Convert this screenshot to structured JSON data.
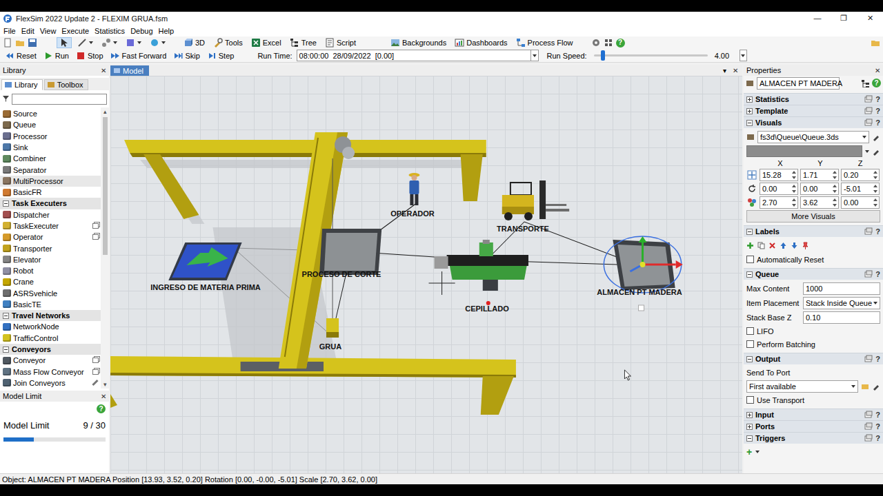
{
  "window": {
    "title": "FlexSim 2022 Update 2 - FLEXIM GRUA.fsm",
    "controls": [
      "—",
      "❐",
      "✕"
    ]
  },
  "menu": [
    {
      "label": "File"
    },
    {
      "label": "Edit"
    },
    {
      "label": "View"
    },
    {
      "label": "Execute"
    },
    {
      "label": "Statistics"
    },
    {
      "label": "Debug"
    },
    {
      "label": "Help"
    }
  ],
  "toolbar": {
    "tools": [
      {
        "label": "3D",
        "kind": "3d",
        "group": "left"
      },
      {
        "label": "Tools",
        "kind": "tools",
        "group": "left"
      },
      {
        "label": "Excel",
        "kind": "excel",
        "group": "left"
      },
      {
        "label": "Tree",
        "kind": "tree",
        "group": "left"
      },
      {
        "label": "Script",
        "kind": "script",
        "group": "left"
      },
      {
        "label": "Backgrounds",
        "kind": "backgrounds",
        "group": "right"
      },
      {
        "label": "Dashboards",
        "kind": "dashboards",
        "group": "right"
      },
      {
        "label": "Process Flow",
        "kind": "flow",
        "group": "right"
      }
    ],
    "help": "?"
  },
  "run_bar": {
    "buttons": [
      {
        "label": "Reset",
        "kind": "reset"
      },
      {
        "label": "Run",
        "kind": "run"
      },
      {
        "label": "Stop",
        "kind": "stop"
      },
      {
        "label": "Fast Forward",
        "kind": "ff"
      },
      {
        "label": "Skip",
        "kind": "skip"
      },
      {
        "label": "Step",
        "kind": "step"
      }
    ],
    "time_label": "Run Time:",
    "time": "08:00:00  28/09/2022  [0.00]",
    "speed_label": "Run Speed:",
    "speed": "4.00",
    "speed_level": 0.08
  },
  "library": {
    "title": "Library",
    "close": "✕",
    "tabs": [
      {
        "label": "Library",
        "selected": true
      },
      {
        "label": "Toolbox",
        "selected": false
      }
    ],
    "search": {
      "placeholder": ""
    },
    "scroll_up": "▴",
    "scroll_down": "▾",
    "items": [
      {
        "kind": "item",
        "label": "Source",
        "color": "#9a6b33",
        "marker": "none",
        "highlighted": false
      },
      {
        "kind": "item",
        "label": "Queue",
        "color": "#7d6a4d",
        "marker": "none",
        "highlighted": false
      },
      {
        "kind": "item",
        "label": "Processor",
        "color": "#6b6f8f",
        "marker": "none",
        "highlighted": false
      },
      {
        "kind": "item",
        "label": "Sink",
        "color": "#4e78a8",
        "marker": "none",
        "highlighted": false
      },
      {
        "kind": "item",
        "label": "Combiner",
        "color": "#5f8a5f",
        "marker": "none",
        "highlighted": false
      },
      {
        "kind": "item",
        "label": "Separator",
        "color": "#7a7a7a",
        "marker": "none",
        "highlighted": false
      },
      {
        "kind": "item",
        "label": "MultiProcessor",
        "color": "#8a7560",
        "marker": "none",
        "highlighted": true
      },
      {
        "kind": "item",
        "label": "BasicFR",
        "color": "#d07a30",
        "marker": "none",
        "highlighted": false
      },
      {
        "kind": "category",
        "label": "Task Executers",
        "expanded": true
      },
      {
        "kind": "item",
        "label": "Dispatcher",
        "color": "#a34f4f",
        "marker": "none",
        "highlighted": false
      },
      {
        "kind": "item",
        "label": "TaskExecuter",
        "color": "#d2b030",
        "marker": "box",
        "highlighted": false
      },
      {
        "kind": "item",
        "label": "Operator",
        "color": "#d59a2a",
        "marker": "box",
        "highlighted": false
      },
      {
        "kind": "item",
        "label": "Transporter",
        "color": "#c2a31e",
        "marker": "none",
        "highlighted": false
      },
      {
        "kind": "item",
        "label": "Elevator",
        "color": "#858585",
        "marker": "none",
        "highlighted": false
      },
      {
        "kind": "item",
        "label": "Robot",
        "color": "#8f8fa3",
        "marker": "none",
        "highlighted": false
      },
      {
        "kind": "item",
        "label": "Crane",
        "color": "#c4a600",
        "marker": "none",
        "highlighted": false
      },
      {
        "kind": "item",
        "label": "ASRSvehicle",
        "color": "#6e6e6e",
        "marker": "none",
        "highlighted": false
      },
      {
        "kind": "item",
        "label": "BasicTE",
        "color": "#3f80c2",
        "marker": "none",
        "highlighted": false
      },
      {
        "kind": "category",
        "label": "Travel Networks",
        "expanded": true
      },
      {
        "kind": "item",
        "label": "NetworkNode",
        "color": "#3270c0",
        "marker": "none",
        "highlighted": false
      },
      {
        "kind": "item",
        "label": "TrafficControl",
        "color": "#d3c21f",
        "marker": "none",
        "highlighted": false
      },
      {
        "kind": "category",
        "label": "Conveyors",
        "expanded": true
      },
      {
        "kind": "item",
        "label": "Conveyor",
        "color": "#505860",
        "marker": "box",
        "highlighted": false
      },
      {
        "kind": "item",
        "label": "Mass Flow Conveyor",
        "color": "#5f7282",
        "marker": "box",
        "highlighted": false
      },
      {
        "kind": "item",
        "label": "Join Conveyors",
        "color": "#4f6272",
        "marker": "pen",
        "highlighted": false
      }
    ]
  },
  "model_limit": {
    "title": "Model Limit",
    "close": "✕",
    "help": "?",
    "label": "Model Limit",
    "count": "9 / 30",
    "level": 0.3
  },
  "model": {
    "tab": "Model",
    "menu": "▾",
    "close": "✕",
    "objects": [
      {
        "kind": "crane",
        "name": "GRUA",
        "selected": false
      },
      {
        "kind": "source",
        "name": "INGRESO DE MATERIA PRIMA",
        "selected": false
      },
      {
        "kind": "processor",
        "name": "PROCESO DE CORTE",
        "selected": false
      },
      {
        "kind": "operator",
        "name": "OPERADOR",
        "selected": false
      },
      {
        "kind": "transporter",
        "name": "TRANSPORTE",
        "selected": false
      },
      {
        "kind": "conveyor",
        "name": "CEPILLADO",
        "selected": false
      },
      {
        "kind": "queue",
        "name": "ALMACEN PT MADERA",
        "selected": true
      }
    ],
    "connections": [
      {
        "from": "source",
        "to": "processor"
      },
      {
        "from": "processor",
        "to": "conveyor"
      },
      {
        "from": "conveyor",
        "to": "queue"
      },
      {
        "from": "source",
        "to": "crane"
      },
      {
        "from": "processor",
        "to": "crane"
      },
      {
        "from": "operator",
        "to": "processor"
      },
      {
        "from": "transporter",
        "to": "conveyor"
      },
      {
        "from": "transporter",
        "to": "queue"
      }
    ]
  },
  "properties": {
    "title": "Properties",
    "close": "✕",
    "help": "?",
    "object_name": "ALMACEN PT MADERA",
    "statistics": {
      "label": "Statistics",
      "expanded": false
    },
    "template": {
      "label": "Template",
      "expanded": false
    },
    "visuals": {
      "label": "Visuals",
      "expanded": true,
      "shape": "fs3d\\Queue\\Queue.3ds",
      "swatch": "#8c8c8c",
      "axes": [
        "X",
        "Y",
        "Z"
      ],
      "rows": [
        {
          "kind": "position",
          "values": [
            "15.28",
            "1.71",
            "0.20"
          ]
        },
        {
          "kind": "rotation",
          "values": [
            "0.00",
            "0.00",
            "-5.01"
          ]
        },
        {
          "kind": "scale",
          "values": [
            "2.70",
            "3.62",
            "0.00"
          ]
        }
      ],
      "more": "More Visuals"
    },
    "labels": {
      "label": "Labels",
      "expanded": true,
      "auto_reset": {
        "label": "Automatically Reset",
        "checked": false
      }
    },
    "queue": {
      "label": "Queue",
      "expanded": true,
      "fields": [
        {
          "label": "Max Content",
          "value": "1000",
          "kind": "text"
        },
        {
          "label": "Item Placement",
          "value": "Stack Inside Queue",
          "kind": "select"
        },
        {
          "label": "Stack Base Z",
          "value": "0.10",
          "kind": "text"
        }
      ],
      "checks": [
        {
          "label": "LIFO",
          "checked": false
        },
        {
          "label": "Perform Batching",
          "checked": false
        }
      ]
    },
    "output": {
      "label": "Output",
      "expanded": true,
      "send_label": "Send To Port",
      "send_value": "First available",
      "use_transport": {
        "label": "Use Transport",
        "checked": false
      }
    },
    "tail": [
      {
        "label": "Input",
        "expanded": false
      },
      {
        "label": "Ports",
        "expanded": false
      },
      {
        "label": "Triggers",
        "expanded": true,
        "add": "+"
      }
    ]
  },
  "status_bar": {
    "text": "Object: ALMACEN PT MADERA Position [13.93, 3.52, 0.20] Rotation [0.00, -0.00, -5.01] Scale [2.70, 3.62, 0.00]"
  }
}
